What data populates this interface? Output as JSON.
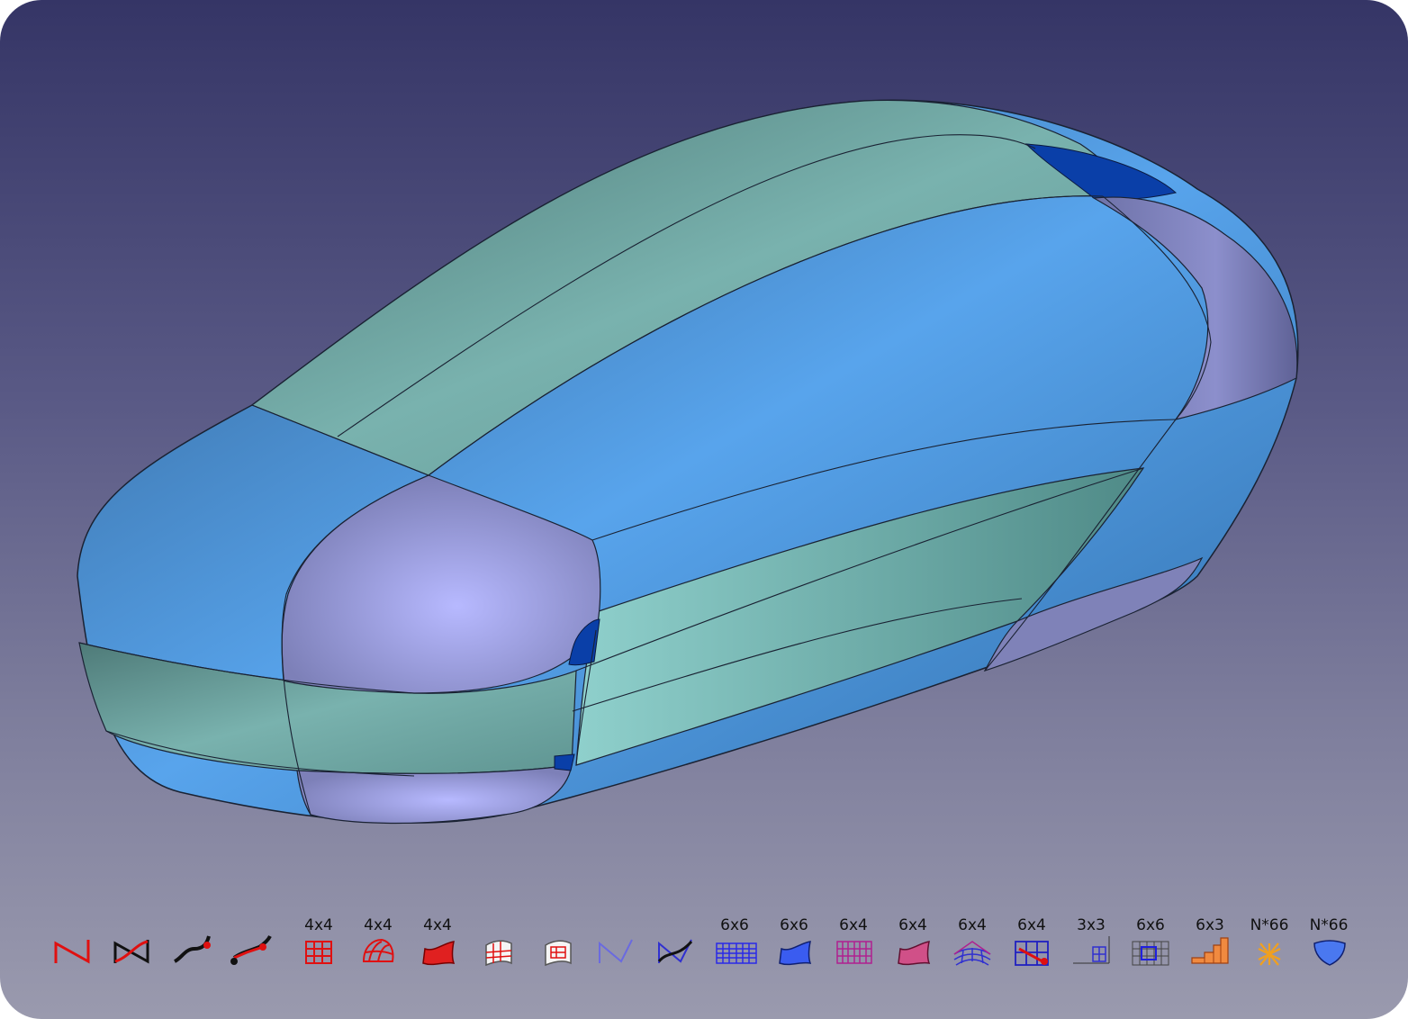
{
  "viewport": {
    "name": "3D view",
    "background_top": "#353566",
    "background_bottom": "#9a9aae"
  },
  "model": {
    "face_colors": {
      "teal": "#6aa3a0",
      "blue": "#3d77b0",
      "lavender": "#8a8ac6",
      "dark_blue": "#0a3fa8"
    }
  },
  "toolbar": {
    "tools": [
      {
        "icon": "line-segment-icon",
        "label": ""
      },
      {
        "icon": "bspline-compare-icon",
        "label": ""
      },
      {
        "icon": "blend-curve-icon",
        "label": ""
      },
      {
        "icon": "blend-curve-points-icon",
        "label": ""
      },
      {
        "icon": "grid-surface-icon",
        "label": "4x4"
      },
      {
        "icon": "sphere-patch-icon",
        "label": "4x4"
      },
      {
        "icon": "red-surface-icon",
        "label": "4x4"
      },
      {
        "icon": "white-surface-icon",
        "label": ""
      },
      {
        "icon": "white-surface-2-icon",
        "label": ""
      },
      {
        "icon": "thin-curve-icon",
        "label": ""
      },
      {
        "icon": "dark-curve-icon",
        "label": ""
      },
      {
        "icon": "blue-grid-icon",
        "label": "6x6"
      },
      {
        "icon": "blue-surface-icon",
        "label": "6x6"
      },
      {
        "icon": "purple-grid-icon",
        "label": "6x4"
      },
      {
        "icon": "pink-surface-icon",
        "label": "6x4"
      },
      {
        "icon": "curved-grid-icon",
        "label": "6x4"
      },
      {
        "icon": "grid-points-icon",
        "label": "6x4"
      },
      {
        "icon": "corner-grid-icon",
        "label": "3x3"
      },
      {
        "icon": "split-grid-icon",
        "label": "6x6"
      },
      {
        "icon": "orange-stair-icon",
        "label": "6x3"
      },
      {
        "icon": "star-points-icon",
        "label": "N*66"
      },
      {
        "icon": "blue-shield-icon",
        "label": "N*66"
      }
    ]
  }
}
